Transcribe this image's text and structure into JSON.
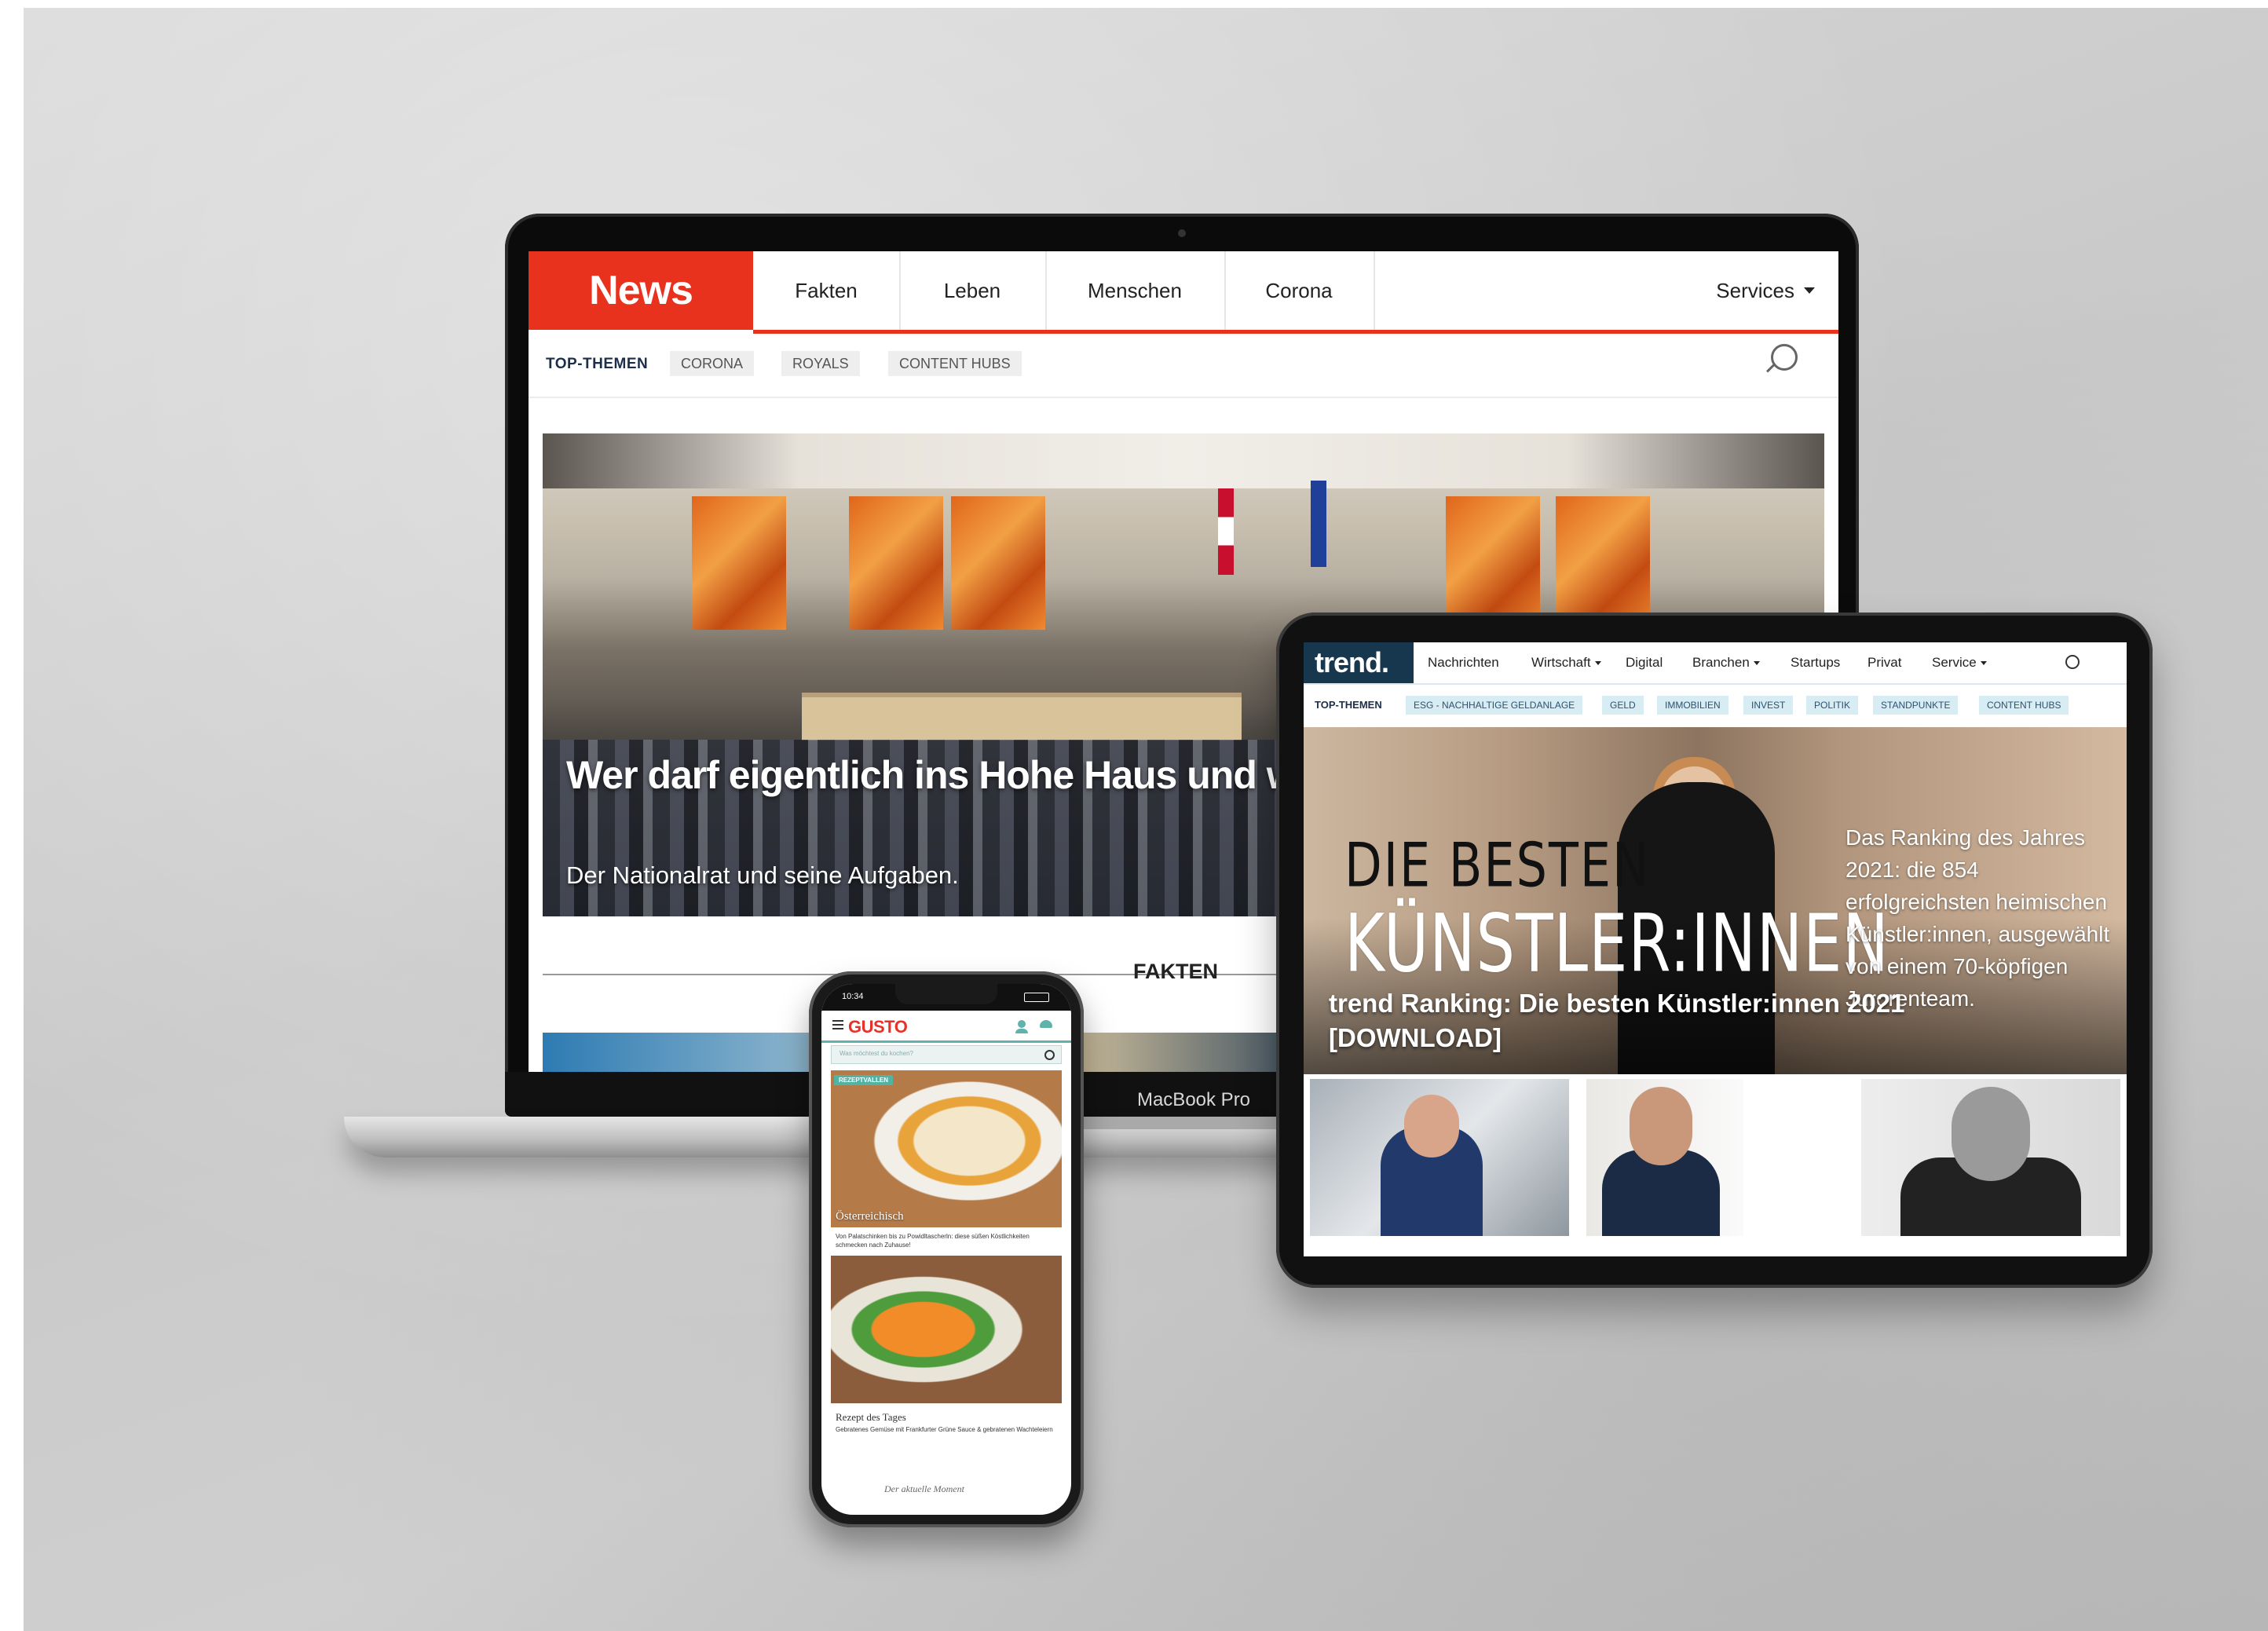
{
  "news": {
    "logo": "News",
    "nav": [
      "Fakten",
      "Leben",
      "Menschen",
      "Corona"
    ],
    "services": "Services",
    "topics_label": "TOP-THEMEN",
    "topics": [
      "CORONA",
      "ROYALS",
      "CONTENT HUBS"
    ],
    "hero_title": "Wer darf eigentlich ins Hohe Haus und wer sind die Abgeordnete?",
    "hero_subtitle": "Der Nationalrat und seine Aufgaben.",
    "section_label": "FAKTEN",
    "accent_color": "#e8321e"
  },
  "laptop": {
    "label": "MacBook Pro"
  },
  "trend": {
    "logo": "trend.",
    "nav": [
      {
        "label": "Nachrichten",
        "dropdown": false
      },
      {
        "label": "Wirtschaft",
        "dropdown": true
      },
      {
        "label": "Digital",
        "dropdown": false
      },
      {
        "label": "Branchen",
        "dropdown": true
      },
      {
        "label": "Startups",
        "dropdown": false
      },
      {
        "label": "Privat",
        "dropdown": false
      },
      {
        "label": "Service",
        "dropdown": true
      }
    ],
    "topics_label": "TOP-THEMEN",
    "topics": [
      "ESG - NACHHALTIGE GELDANLAGE",
      "GELD",
      "IMMOBILIEN",
      "INVEST",
      "POLITIK",
      "STANDPUNKTE",
      "CONTENT HUBS"
    ],
    "hero_big_line1": "DIE BESTEN",
    "hero_big_line2": "KÜNSTLER:INNEN",
    "hero_side_text": "Das Ranking des Jahres 2021: die 854 erfolgreichsten heimischen Künstler:innen, ausgewählt von einem 70-köpfigen Jurorenteam.",
    "hero_headline": "trend Ranking: Die besten Künstler:innen 2021 [DOWNLOAD]",
    "brand_color": "#17374f",
    "chip_color": "#d8ecf4"
  },
  "gusto": {
    "time": "10:34",
    "logo": "GUSTO",
    "search_placeholder": "Was möchtest du kochen?",
    "tag": "REZEPTVALLEN",
    "category": "Österreichisch",
    "caption1": "Von Palatschinken bis zu Powidltascherln: diese süßen Köstlichkeiten schmecken nach Zuhause!",
    "caption2_title": "Rezept des Tages",
    "caption2": "Gebratenes Gemüse mit Frankfurter Grüne Sauce & gebratenen Wachteleiern",
    "footer": "Der aktuelle Moment",
    "accent_color": "#e7322a",
    "teal_color": "#5fb3ab"
  }
}
